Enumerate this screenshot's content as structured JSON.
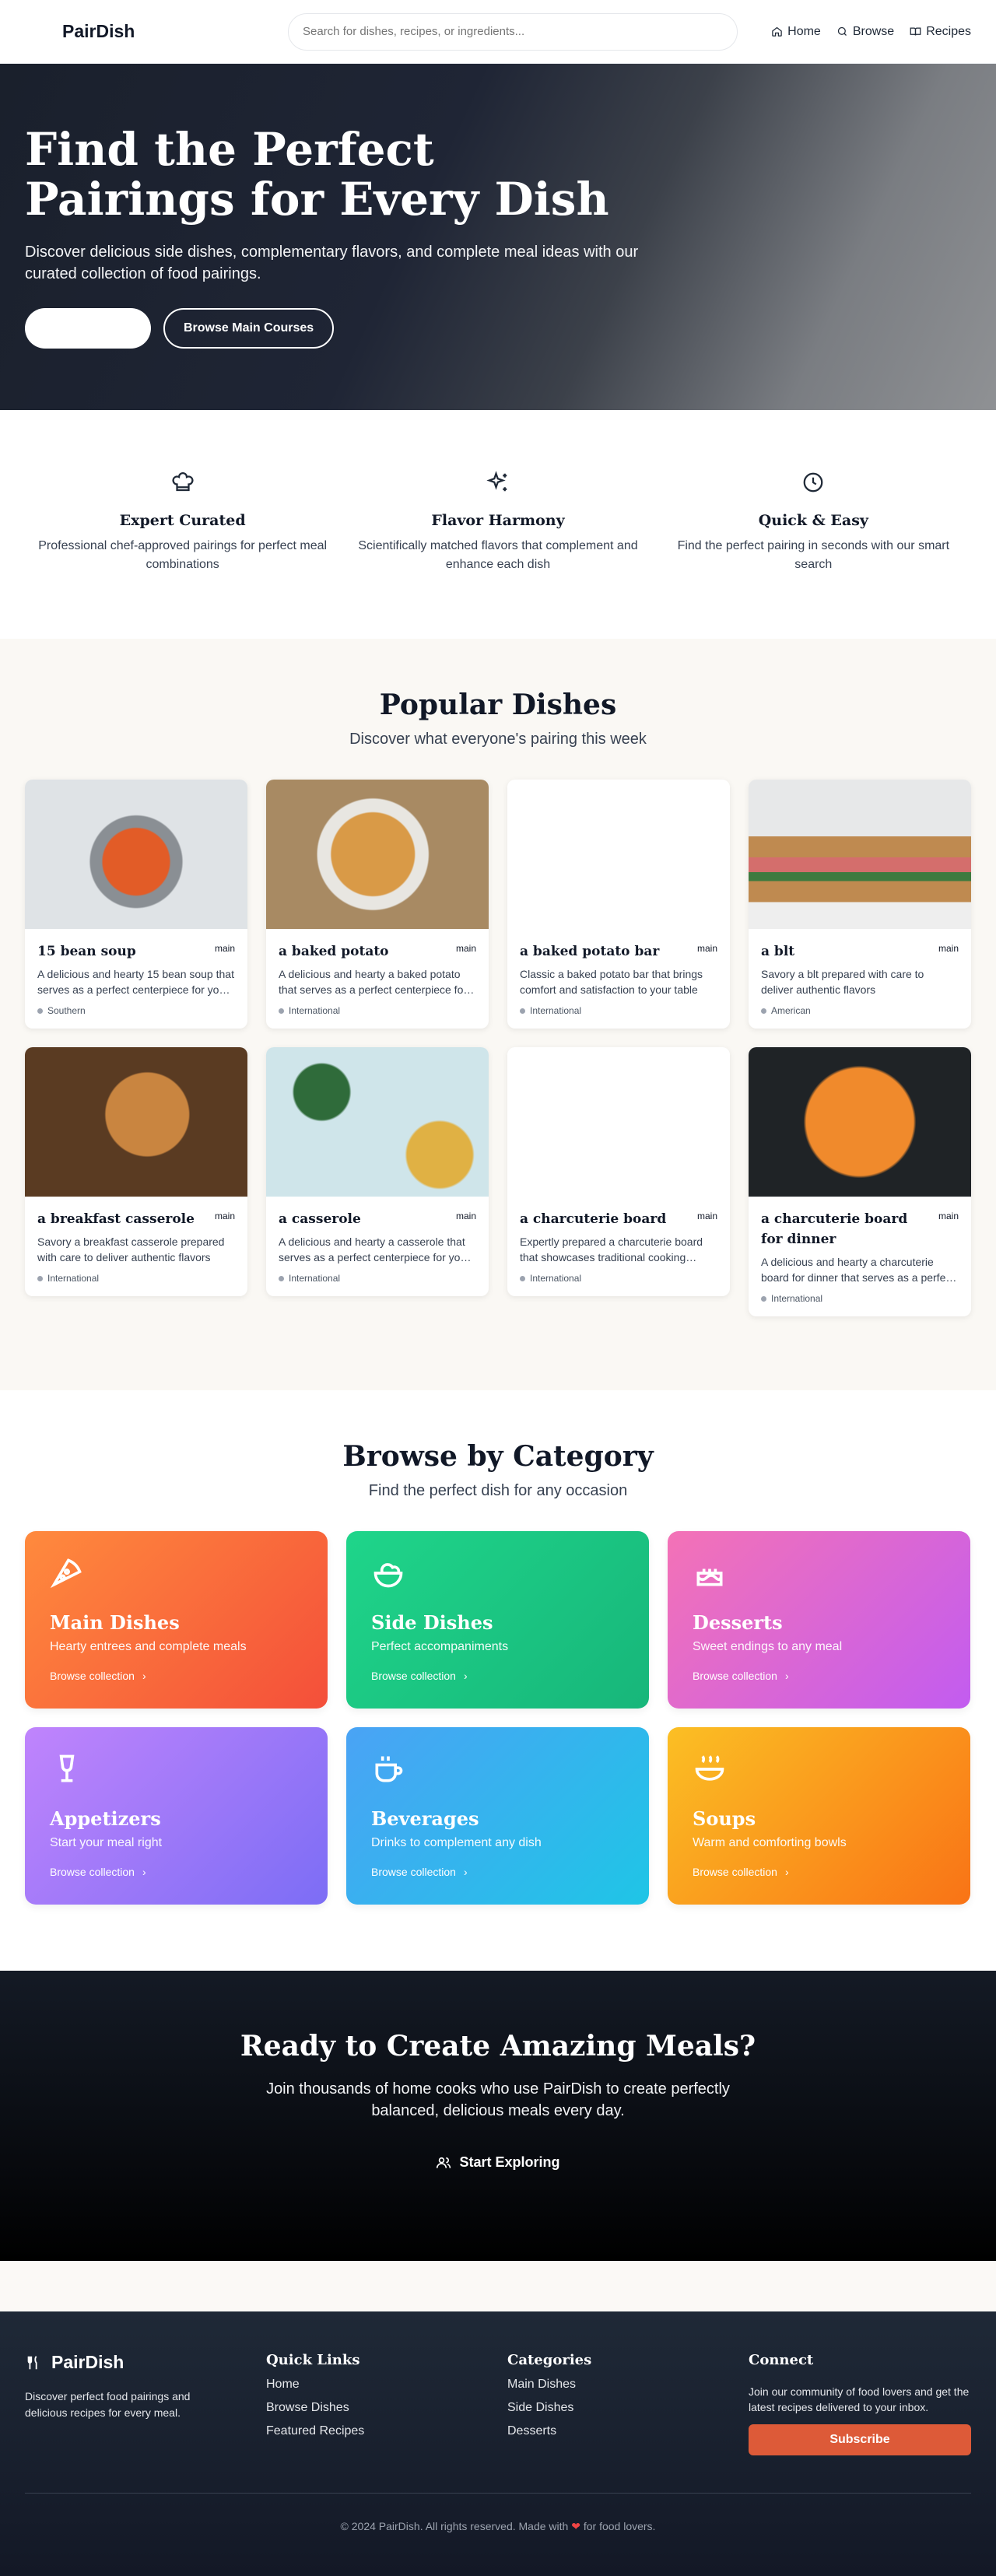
{
  "header": {
    "logo": "PairDish",
    "search_placeholder": "Search for dishes, recipes, or ingredients...",
    "nav": [
      {
        "label": "Home",
        "icon": "home-icon"
      },
      {
        "label": "Browse",
        "icon": "search-icon"
      },
      {
        "label": "Recipes",
        "icon": "book-icon"
      }
    ]
  },
  "hero": {
    "title": "Find the Perfect Pairings for Every Dish",
    "subtitle": "Discover delicious side dishes, complementary flavors, and complete meal ideas with our curated collection of food pairings.",
    "secondary_button": "Browse Main Courses"
  },
  "features": [
    {
      "icon": "chef-hat-icon",
      "title": "Expert Curated",
      "desc": "Professional chef-approved pairings for perfect meal combinations"
    },
    {
      "icon": "sparkles-icon",
      "title": "Flavor Harmony",
      "desc": "Scientifically matched flavors that complement and enhance each dish"
    },
    {
      "icon": "clock-icon",
      "title": "Quick & Easy",
      "desc": "Find the perfect pairing in seconds with our smart search"
    }
  ],
  "popular": {
    "title": "Popular Dishes",
    "subtitle": "Discover what everyone's pairing this week",
    "cards": [
      {
        "title": "15 bean soup",
        "badge": "main",
        "desc": "A delicious and hearty 15 bean soup that serves as a perfect centerpiece for your meal",
        "tag": "Southern",
        "img": "img-soup"
      },
      {
        "title": "a baked potato",
        "badge": "main",
        "desc": "A delicious and hearty a baked potato that serves as a perfect centerpiece for your meal",
        "tag": "International",
        "img": "img-fries"
      },
      {
        "title": "a baked potato bar",
        "badge": "main",
        "desc": "Classic a baked potato bar that brings comfort and satisfaction to your table",
        "tag": "International",
        "img": "img-blank"
      },
      {
        "title": "a blt",
        "badge": "main",
        "desc": "Savory a blt prepared with care to deliver authentic flavors",
        "tag": "American",
        "img": "img-blt"
      },
      {
        "title": "a breakfast casserole",
        "badge": "main",
        "desc": "Savory a breakfast casserole prepared with care to deliver authentic flavors",
        "tag": "International",
        "img": "img-cass"
      },
      {
        "title": "a casserole",
        "badge": "main",
        "desc": "A delicious and hearty a casserole that serves as a perfect centerpiece for your meal",
        "tag": "International",
        "img": "img-salad"
      },
      {
        "title": "a charcuterie board",
        "badge": "main",
        "desc": "Expertly prepared a charcuterie board that showcases traditional cooking techniques",
        "tag": "International",
        "img": "img-blank"
      },
      {
        "title": "a charcuterie board for dinner",
        "badge": "main",
        "desc": "A delicious and hearty a charcuterie board for dinner that serves as a perfect centerpiece",
        "tag": "International",
        "img": "img-salmon"
      }
    ]
  },
  "categories": {
    "title": "Browse by Category",
    "subtitle": "Find the perfect dish for any occasion",
    "link_label": "Browse collection",
    "items": [
      {
        "name": "Main Dishes",
        "desc": "Hearty entrees and complete meals",
        "icon": "pizza-icon",
        "grad": "grad-orange"
      },
      {
        "name": "Side Dishes",
        "desc": "Perfect accompaniments",
        "icon": "salad-icon",
        "grad": "grad-green"
      },
      {
        "name": "Desserts",
        "desc": "Sweet endings to any meal",
        "icon": "cake-icon",
        "grad": "grad-pink"
      },
      {
        "name": "Appetizers",
        "desc": "Start your meal right",
        "icon": "wine-icon",
        "grad": "grad-violet"
      },
      {
        "name": "Beverages",
        "desc": "Drinks to complement any dish",
        "icon": "coffee-icon",
        "grad": "grad-blue"
      },
      {
        "name": "Soups",
        "desc": "Warm and comforting bowls",
        "icon": "soup-icon",
        "grad": "grad-amber"
      }
    ]
  },
  "cta": {
    "title": "Ready to Create Amazing Meals?",
    "subtitle": "Join thousands of home cooks who use PairDish to create perfectly balanced, delicious meals every day.",
    "button": "Start Exploring"
  },
  "footer": {
    "logo": "PairDish",
    "desc": "Discover perfect food pairings and delicious recipes for every meal.",
    "quick_links_title": "Quick Links",
    "quick_links": [
      "Home",
      "Browse Dishes",
      "Featured Recipes"
    ],
    "categories_title": "Categories",
    "categories": [
      "Main Dishes",
      "Side Dishes",
      "Desserts"
    ],
    "connect_title": "Connect",
    "connect_desc": "Join our community of food lovers and get the latest recipes delivered to your inbox.",
    "subscribe": "Subscribe",
    "copyright_before": "© 2024 PairDish. All rights reserved. Made with",
    "copyright_after": "for food lovers."
  },
  "colors": {
    "accent": "#dd5a38",
    "dark": "#1f2937"
  }
}
